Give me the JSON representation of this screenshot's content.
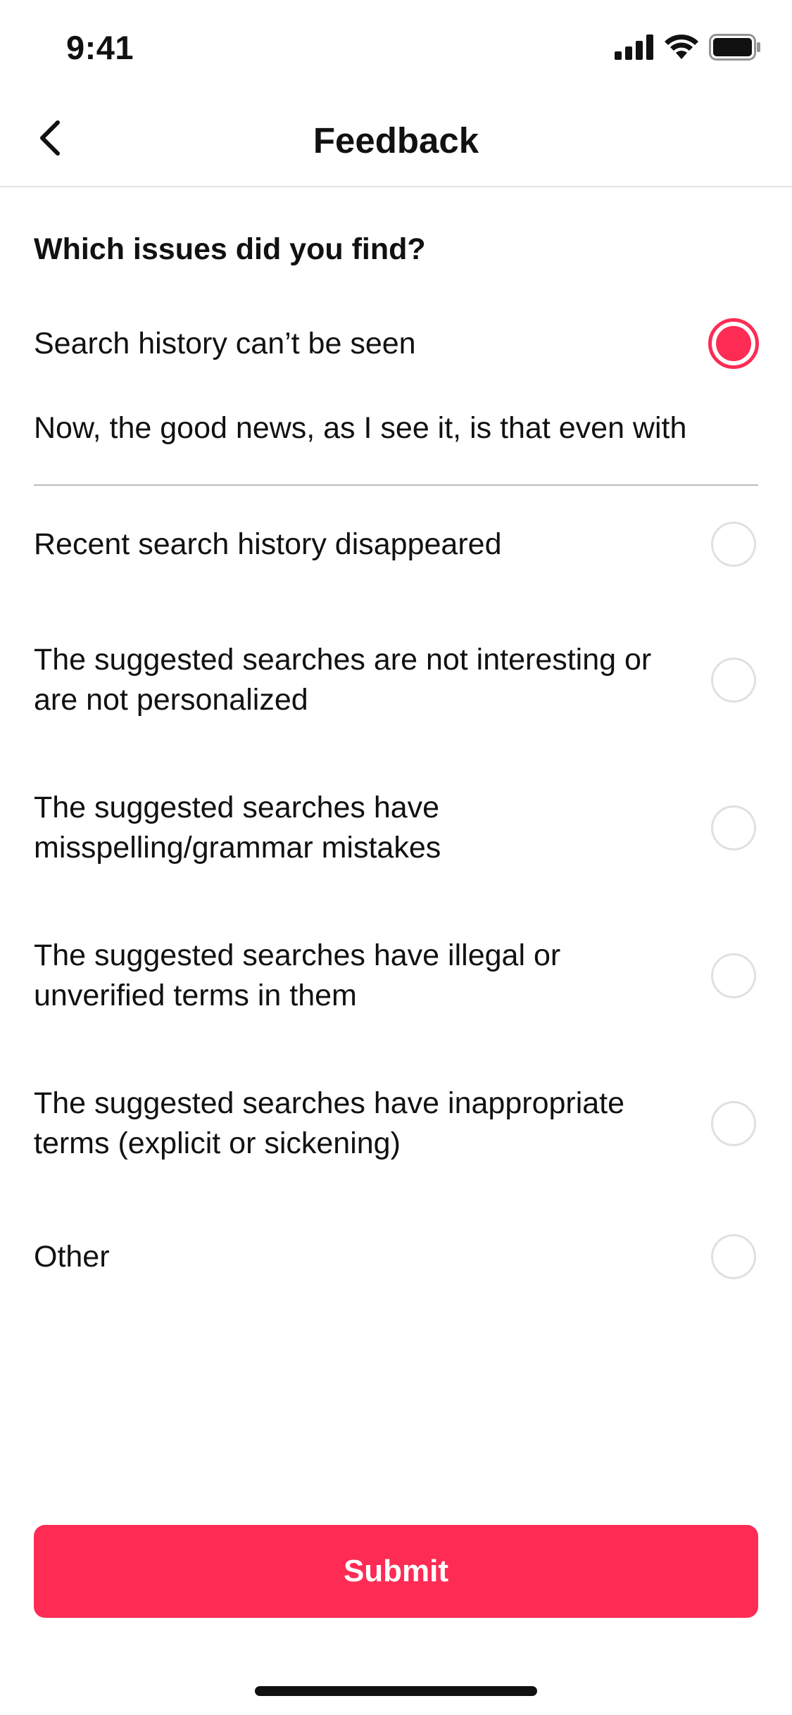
{
  "status_bar": {
    "time": "9:41"
  },
  "nav": {
    "title": "Feedback"
  },
  "question": "Which issues did you find?",
  "options": [
    {
      "label": "Search history can’t be seen",
      "selected": true
    },
    {
      "label": "Recent search history disappeared",
      "selected": false
    },
    {
      "label": "The suggested searches are not interesting or are not personalized",
      "selected": false
    },
    {
      "label": "The suggested searches have misspelling/grammar mistakes",
      "selected": false
    },
    {
      "label": "The suggested searches have illegal or unverified terms in them",
      "selected": false
    },
    {
      "label": "The suggested searches have inappropriate terms (explicit or sickening)",
      "selected": false
    },
    {
      "label": "Other",
      "selected": false
    }
  ],
  "detail_input": {
    "value": "Now, the good news, as I see it, is that even with"
  },
  "submit": {
    "label": "Submit"
  },
  "colors": {
    "accent": "#fe2c55",
    "radio_border": "#e0e0e0",
    "divider": "#e3e3e3"
  },
  "icons": {
    "back": "chevron-left-icon",
    "signal": "cellular-signal-icon",
    "wifi": "wifi-icon",
    "battery": "battery-icon"
  }
}
